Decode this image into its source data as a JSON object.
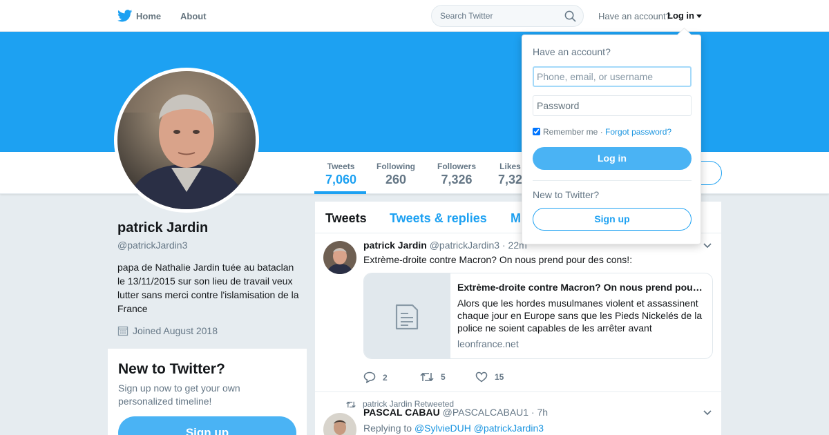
{
  "nav": {
    "home_label": "Home",
    "about_label": "About",
    "search_placeholder": "Search Twitter",
    "have_account": "Have an account?",
    "login_label": "Log in"
  },
  "profile": {
    "name": "patrick Jardin",
    "handle": "@patrickJardin3",
    "bio": "papa de Nathalie Jardin tuée au bataclan le 13/11/2015 sur son lieu de travail veux lutter sans merci contre l'islamisation de la France",
    "joined": "Joined August 2018",
    "banner_color": "#1da1f2"
  },
  "stats": [
    {
      "label": "Tweets",
      "value": "7,060",
      "active": true
    },
    {
      "label": "Following",
      "value": "260"
    },
    {
      "label": "Followers",
      "value": "7,326"
    },
    {
      "label": "Likes",
      "value": "7,32"
    }
  ],
  "signup_card": {
    "title": "New to Twitter?",
    "subtitle": "Sign up now to get your own personalized timeline!",
    "button": "Sign up"
  },
  "timeline": {
    "tabs": [
      "Tweets",
      "Tweets & replies",
      "M"
    ],
    "tweets": [
      {
        "name": "patrick Jardin",
        "handle": "@patrickJardin3",
        "time": "· 22m",
        "text": "Extrème-droite contre Macron? On nous prend pour des cons!:",
        "card": {
          "title": "Extrème-droite contre Macron? On nous prend pour des cons!",
          "description": "Alors que les hordes musulmanes violent et assassinent chaque jour en Europe sans que les Pieds Nickelés de la police ne soient capables de les arrêter avant",
          "domain": "leonfrance.net"
        },
        "replies": "2",
        "retweets": "5",
        "likes": "15"
      },
      {
        "retweeted_by": "patrick Jardin Retweeted",
        "name": "PASCAL CABAU",
        "handle": "@PASCALCABAU1",
        "time": "· 7h",
        "reply_prefix": "Replying to",
        "reply_to": "@SylvieDUH @patrickJardin3"
      }
    ]
  },
  "login_dropdown": {
    "title": "Have an account?",
    "username_placeholder": "Phone, email, or username",
    "password_placeholder": "Password",
    "remember_label": "Remember me",
    "remember_checked": true,
    "separator": "·",
    "forgot_label": "Forgot password?",
    "login_button": "Log in",
    "new_label": "New to Twitter?",
    "signup_button": "Sign up"
  },
  "colors": {
    "accent": "#1da1f2",
    "button": "#4ab3f4",
    "link": "#1b95e0",
    "muted": "#657786"
  },
  "icons": [
    "twitter-bird-icon",
    "search-icon",
    "calendar-icon",
    "document-icon",
    "reply-icon",
    "retweet-icon",
    "heart-icon",
    "chevron-down-icon"
  ]
}
